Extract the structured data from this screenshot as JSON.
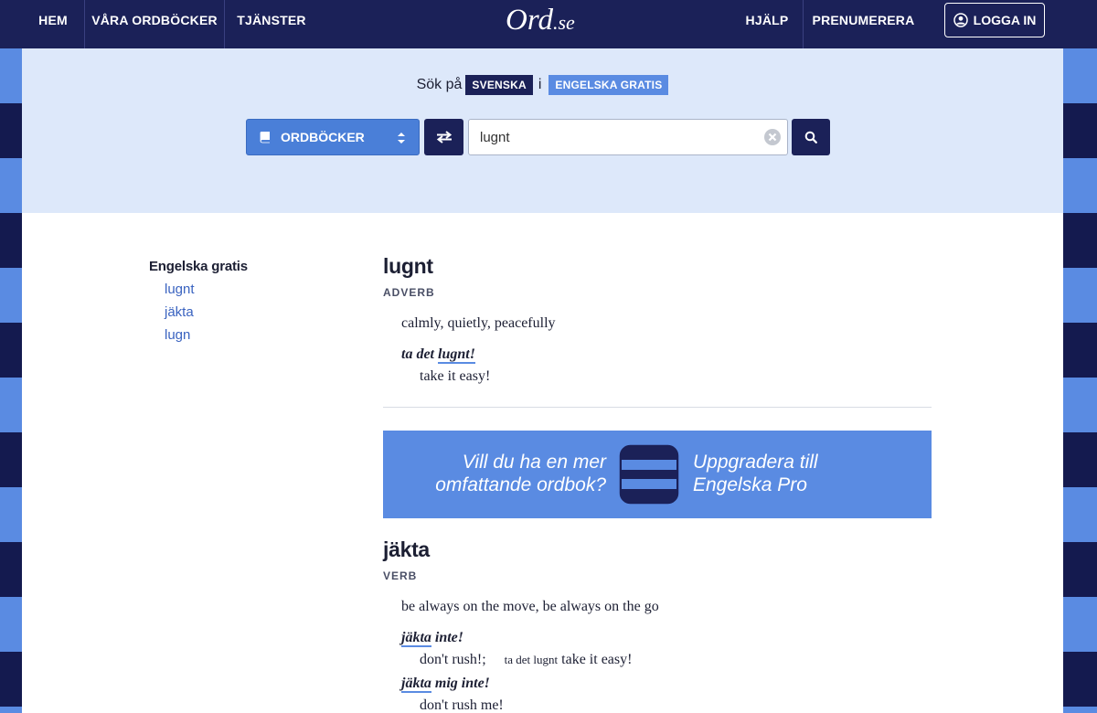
{
  "nav": {
    "home": "HEM",
    "dictionaries": "VÅRA ORDBÖCKER",
    "services": "TJÄNSTER",
    "logo_main": "Ord",
    "logo_tld": ".se",
    "help": "HJÄLP",
    "subscribe": "PRENUMERERA",
    "login": "LOGGA IN"
  },
  "search": {
    "prefix": "Sök på",
    "source_lang": "SVENSKA",
    "connector": "i",
    "target_dict": "ENGELSKA GRATIS",
    "dict_select_label": "ORDBÖCKER",
    "query": "lugnt"
  },
  "sidebar": {
    "heading": "Engelska gratis",
    "links": [
      "lugnt",
      "jäkta",
      "lugn"
    ]
  },
  "entries": [
    {
      "word": "lugnt",
      "pos": "ADVERB",
      "definition": "calmly, quietly, peacefully",
      "examples": [
        {
          "pre": "ta det ",
          "kw": "lugnt!",
          "post": "",
          "translation": "take it easy!"
        }
      ]
    },
    {
      "word": "jäkta",
      "pos": "VERB",
      "definition": "be always on the move, be always on the go",
      "examples": [
        {
          "pre": "",
          "kw": "jäkta",
          "post": " inte!",
          "translation": "don't rush!;",
          "aside": "ta det lugnt",
          "aside_translation": "take it easy!"
        },
        {
          "pre": "",
          "kw": "jäkta",
          "post": " mig inte!",
          "translation": "don't rush me!"
        }
      ]
    }
  ],
  "promo": {
    "question": "Vill du ha en mer omfattande ordbok?",
    "cta": "Uppgradera till Engelska Pro"
  },
  "colors": {
    "navy": "#1b2158",
    "accent_blue": "#5a8be2",
    "band_bg": "#dde8fa",
    "link": "#3a63c0"
  }
}
